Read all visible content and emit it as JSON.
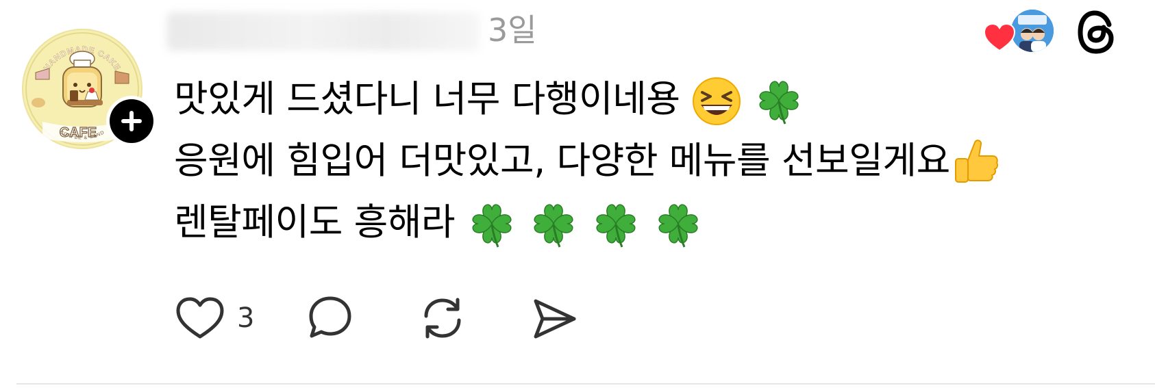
{
  "post": {
    "author": {
      "avatar_text_top": "HANDMADE CAKE",
      "avatar_text_bottom": "CAFE",
      "avatar_text_sub": "COFFEE & SAND"
    },
    "time_ago": "3일",
    "body_lines": [
      "맛있게 드셨다니 너무 다행이네용",
      "응원에 힘입어 더맛있고, 다양한 메뉴를 선보일게요",
      "렌탈페이도 흥해라"
    ],
    "emoji_names": [
      "grinning-squinting-face",
      "four-leaf-clover",
      "thumbs-up",
      "four-leaf-clover"
    ],
    "actions": {
      "like_count": "3"
    }
  },
  "colors": {
    "text": "#000000",
    "muted": "#9a9a9a",
    "heart": "#ff3040",
    "avatar_bg": "#f7efb2",
    "icon": "#333333"
  }
}
